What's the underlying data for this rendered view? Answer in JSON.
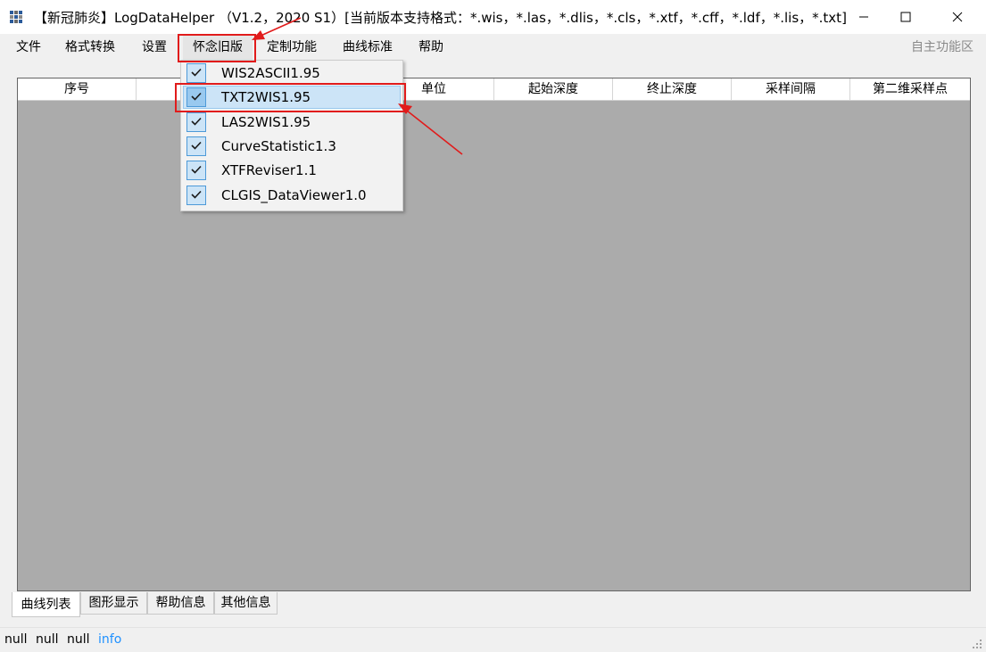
{
  "window": {
    "title": "【新冠肺炎】LogDataHelper （V1.2，2020 S1）[当前版本支持格式：*.wis，*.las，*.dlis，*.cls，*.xtf，*.cff，*.ldf，*.lis，*.txt]",
    "controls": [
      "minimize",
      "maximize",
      "close"
    ]
  },
  "menubar": {
    "items": [
      "文件",
      "格式转换",
      "设置",
      "怀念旧版",
      "定制功能",
      "曲线标准",
      "帮助"
    ],
    "active_index": 3,
    "right_label": "自主功能区"
  },
  "dropdown": {
    "items": [
      {
        "label": "WIS2ASCII1.95",
        "checked": true
      },
      {
        "label": "TXT2WIS1.95",
        "checked": true
      },
      {
        "label": "LAS2WIS1.95",
        "checked": true
      },
      {
        "label": "CurveStatistic1.3",
        "checked": true
      },
      {
        "label": "XTFReviser1.1",
        "checked": true
      },
      {
        "label": "CLGIS_DataViewer1.0",
        "checked": true
      }
    ],
    "hover_index": 1
  },
  "grid": {
    "columns": [
      "序号",
      "",
      "",
      "单位",
      "起始深度",
      "终止深度",
      "采样间隔",
      "第二维采样点"
    ]
  },
  "tabs": {
    "items": [
      "曲线列表",
      "图形显示",
      "帮助信息",
      "其他信息"
    ],
    "selected_index": 0
  },
  "status": {
    "items": [
      "null",
      "null",
      "null",
      "info"
    ],
    "info_color": "#1e90ff"
  },
  "annotation_color": "#e11b1b"
}
